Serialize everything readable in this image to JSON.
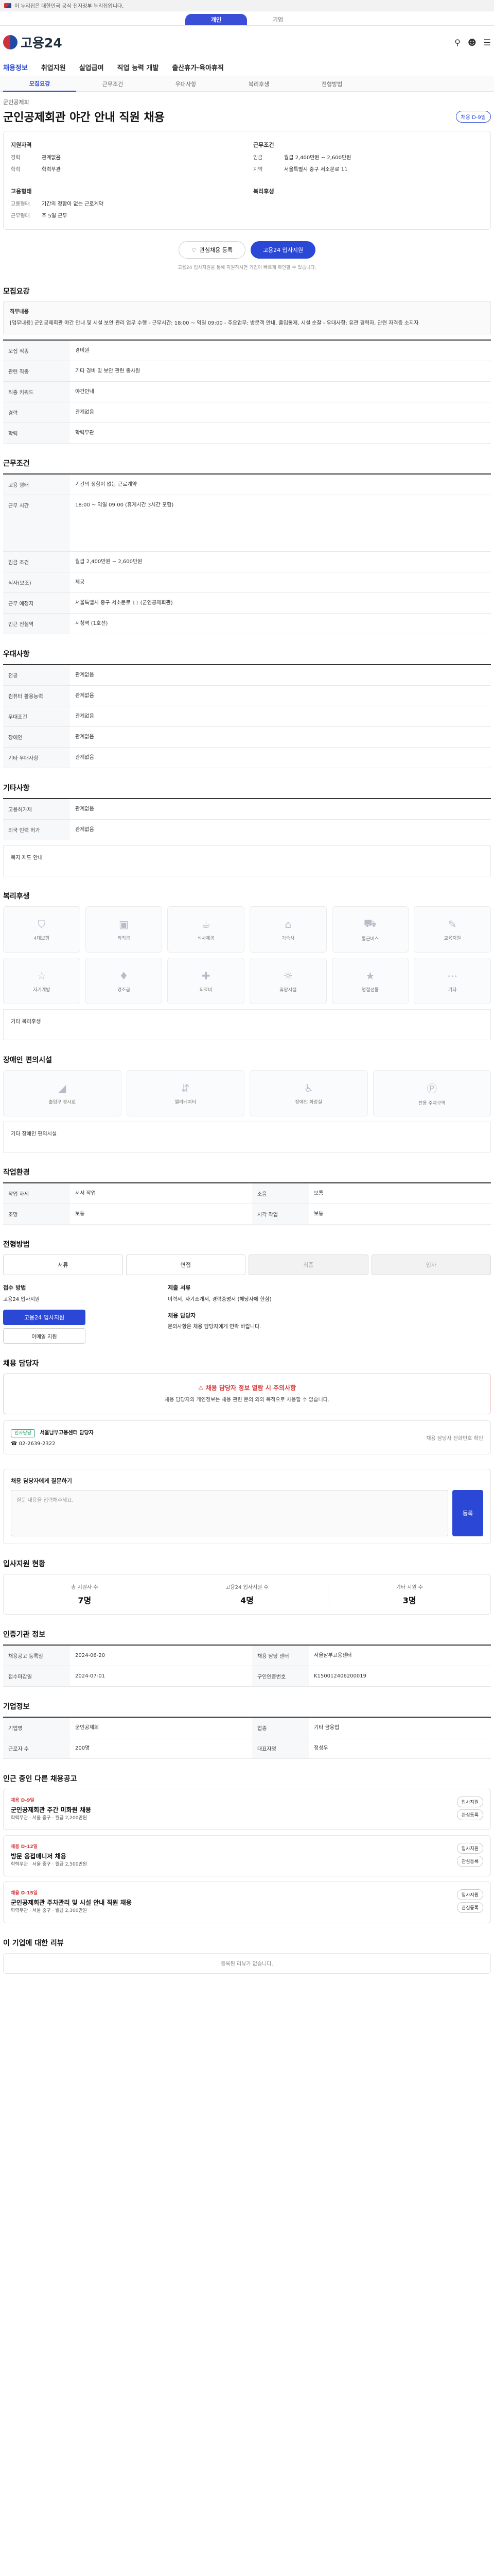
{
  "gov_banner": "이 누리집은 대한민국 공식 전자정부 누리집입니다.",
  "tabs": [
    "개인",
    "기업"
  ],
  "logo_text": "고용24",
  "main_nav": [
    "채용정보",
    "취업지원",
    "실업급여",
    "직업 능력 개발",
    "출산휴가·육아휴직"
  ],
  "sub_nav": [
    "모집요강",
    "근무조건",
    "우대사항",
    "복리후생",
    "전형방법"
  ],
  "job": {
    "company": "군인공제회",
    "title": "군인공제회관 야간 안내 직원 채용",
    "chip": "채용 D-9일",
    "left_title": "지원자격",
    "left_kv": [
      {
        "k": "경력",
        "v": "관계없음"
      },
      {
        "k": "학력",
        "v": "학력무관"
      }
    ],
    "right_title": "근무조건",
    "right_kv": [
      {
        "k": "임금",
        "v": "월급 2,400만원 ~ 2,600만원"
      },
      {
        "k": "지역",
        "v": "서울특별시 중구 서소문로 11"
      }
    ],
    "left_title2": "고용형태",
    "left_kv2": [
      {
        "k": "고용형태",
        "v": "기간의 정함이 없는 근로계약"
      },
      {
        "k": "근무형태",
        "v": "주 5일 근무"
      }
    ],
    "right_title2": "복리후생",
    "right_kv2": []
  },
  "actions": {
    "bookmark": "관심채용 등록",
    "apply": "고용24 입사지원"
  },
  "notice": "고용24 입사지원을 통해 지원하시면 기업이 빠르게 확인할 수 있습니다.",
  "sections": {
    "recruit": {
      "title": "모집요강",
      "duty_label": "직무내용",
      "duty_text": "[업무내용] 군인공제회관 야간 안내 및 시설 보안 관리 업무 수행 - 근무시간: 18:00 ~ 익일 09:00 - 주요업무: 방문객 안내, 출입통제, 시설 순찰 - 우대사항: 유관 경력자, 관련 자격증 소지자",
      "rows": [
        {
          "k": "모집 직종",
          "v": "경비원"
        },
        {
          "k": "관련 직종",
          "v": "기타 경비 및 보안 관련 종사원"
        },
        {
          "k": "직종 키워드",
          "v": "야간안내"
        },
        {
          "k": "경력",
          "v": "관계없음"
        },
        {
          "k": "학력",
          "v": "학력무관"
        }
      ]
    },
    "work": {
      "title": "근무조건",
      "rows": [
        {
          "k": "고용 형태",
          "v": "기간의 정함이 없는 근로계약"
        },
        {
          "k": "근무 시간",
          "v": "18:00 ~ 익일 09:00 (휴게시간 3시간 포함)"
        },
        {
          "k": "임금 조건",
          "v": "월급 2,400만원 ~ 2,600만원"
        },
        {
          "k": "식사(보조)",
          "v": "제공"
        },
        {
          "k": "근무 예정지",
          "v": "서울특별시 중구 서소문로 11 (군인공제회관)"
        },
        {
          "k": "인근 전철역",
          "v": "시청역 (1호선)"
        }
      ]
    },
    "pref": {
      "title": "우대사항",
      "rows": [
        {
          "k": "전공",
          "v": "관계없음"
        },
        {
          "k": "컴퓨터 활용능력",
          "v": "관계없음"
        },
        {
          "k": "우대조건",
          "v": "관계없음"
        },
        {
          "k": "장애인",
          "v": "관계없음"
        },
        {
          "k": "기타 우대사항",
          "v": "관계없음"
        }
      ]
    },
    "etc": {
      "title": "기타사항",
      "rows": [
        {
          "k": "고용허가제",
          "v": "관계없음"
        },
        {
          "k": "외국 인력 허가",
          "v": "관계없음"
        }
      ],
      "note": "복지 제도 안내"
    },
    "welfare": {
      "title": "복리후생",
      "tiles": [
        "4대보험",
        "퇴직금",
        "식사제공",
        "기숙사",
        "통근버스",
        "교육지원",
        "자기계발",
        "경조금",
        "의료비",
        "휴양시설",
        "명절선물",
        "기타"
      ],
      "note": "기타 복리후생"
    },
    "disability": {
      "title": "장애인 편의시설",
      "tiles": [
        "출입구 경사로",
        "엘리베이터",
        "장애인 화장실",
        "전용 주차구역"
      ],
      "note": "기타 장애인 편의시설"
    },
    "env": {
      "title": "작업환경",
      "rows": [
        {
          "k": "작업 자세",
          "v": "서서 작업"
        },
        {
          "k": "소음",
          "v": "보통"
        },
        {
          "k": "조명",
          "v": "보통"
        },
        {
          "k": "시각 작업",
          "v": "보통"
        }
      ]
    },
    "process": {
      "title": "전형방법",
      "steps": [
        "서류",
        "면접",
        "최종",
        "입사"
      ],
      "apply_label": "접수 방법",
      "apply_value": "고용24 입사지원",
      "apply_btn": "고용24 입사지원",
      "apply_btn2": "이메일 지원",
      "docs_label": "제출 서류",
      "docs_text": "이력서, 자기소개서, 경력증명서 (해당자에 한함)",
      "contact_label": "채용 담당자",
      "contact_text": "문의사항은 채용 담당자에게 연락 바랍니다."
    },
    "manager": {
      "title": "채용 담당자",
      "warning_title": "채용 담당자 정보 열람 시 주의사항",
      "warning_text": "채용 담당자의 개인정보는 채용 관련 문의 외의 목적으로 사용할 수 없습니다.",
      "badge": "인사담당",
      "name": "서울남부고용센터 담당자",
      "phone": "02-2639-2322",
      "note": "채용 담당자 전화번호 확인"
    },
    "qna": {
      "title": "채용 담당자에게 질문하기",
      "placeholder": "질문 내용을 입력해주세요.",
      "button": "등록"
    },
    "stats": {
      "title": "입사지원 현황",
      "items": [
        {
          "label": "총 지원자 수",
          "value": "7명"
        },
        {
          "label": "고용24 입사지원 수",
          "value": "4명"
        },
        {
          "label": "기타 지원 수",
          "value": "3명"
        }
      ]
    },
    "info": {
      "title": "인증기관 정보",
      "rows": [
        {
          "k": "채용공고 등록일",
          "v": "2024-06-20"
        },
        {
          "k": "접수마감일",
          "v": "2024-07-01"
        },
        {
          "k": "채용 담당 센터",
          "v": "서울남부고용센터"
        },
        {
          "k": "구인인증번호",
          "v": "K150012406200019"
        }
      ]
    },
    "company": {
      "title": "기업정보",
      "rows": [
        {
          "k": "기업명",
          "v": "군인공제회"
        },
        {
          "k": "업종",
          "v": "기타 금융업"
        },
        {
          "k": "근로자 수",
          "v": "200명"
        },
        {
          "k": "대표자명",
          "v": "정성우"
        }
      ]
    },
    "related": {
      "title": "인근 중인 다른 채용공고",
      "cards": [
        {
          "sub": "채용 D-9일",
          "title": "군인공제회관 주간 미화원 채용",
          "meta": "학력무관 · 서울 중구 · 월급 2,200만원"
        },
        {
          "sub": "채용 D-12일",
          "title": "방문 응접매니저 채용",
          "meta": "학력무관 · 서울 중구 · 월급 2,500만원"
        },
        {
          "sub": "채용 D-15일",
          "title": "군인공제회관 주차관리 및 시설 안내 직원 채용",
          "meta": "학력무관 · 서울 중구 · 월급 2,300만원"
        }
      ],
      "btn_apply": "입사지원",
      "btn_save": "관심등록"
    },
    "nearby": {
      "title": "이 기업에 대한 리뷰",
      "empty": "등록된 리뷰가 없습니다."
    }
  }
}
